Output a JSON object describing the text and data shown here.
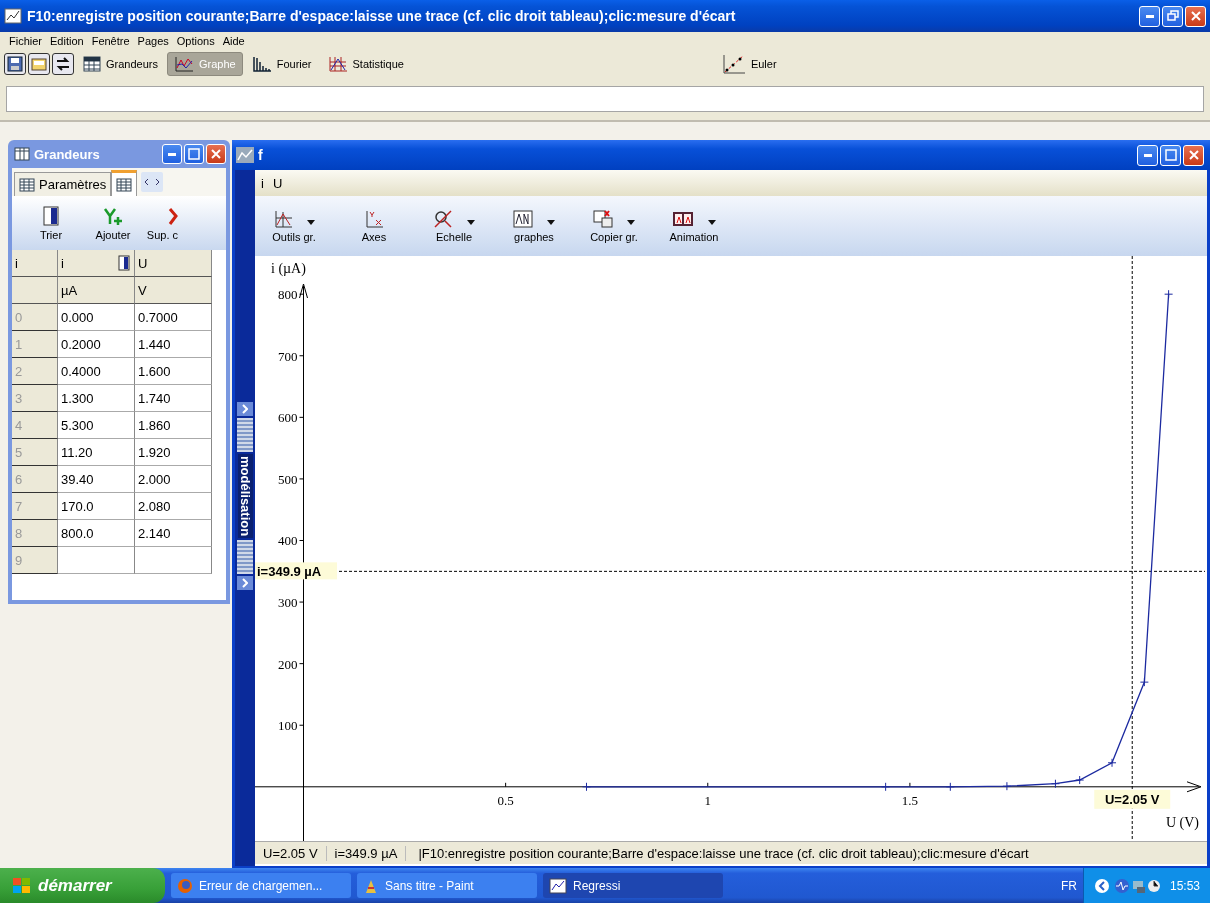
{
  "window": {
    "title": "F10:enregistre position courante;Barre d'espace:laisse une trace (cf. clic droit tableau);clic:mesure d'écart"
  },
  "menu": [
    "Fichier",
    "Edition",
    "Fenêtre",
    "Pages",
    "Options",
    "Aide"
  ],
  "toolbar": [
    {
      "label": "Grandeurs",
      "kind": "grandeurs",
      "selected": false
    },
    {
      "label": "Graphe",
      "kind": "graphe",
      "selected": true
    },
    {
      "label": "Fourier",
      "kind": "fourier",
      "selected": false
    },
    {
      "label": "Statistique",
      "kind": "stat",
      "selected": false
    },
    {
      "label": "Euler",
      "kind": "euler",
      "selected": false
    }
  ],
  "grandeurs": {
    "title": "Grandeurs",
    "tabs": [
      {
        "label": "Paramètres",
        "selected": false
      },
      {
        "selected": true
      }
    ],
    "tools": [
      {
        "label": "Trier",
        "kind": "sort"
      },
      {
        "label": "Ajouter",
        "kind": "add"
      },
      {
        "label": "Sup. c",
        "kind": "delete"
      }
    ],
    "header": [
      "i",
      "i",
      "U"
    ],
    "units": [
      "µA",
      "V"
    ],
    "rows": [
      {
        "index": "0",
        "i": "0.000",
        "u": "0.7000"
      },
      {
        "index": "1",
        "i": "0.2000",
        "u": "1.440"
      },
      {
        "index": "2",
        "i": "0.4000",
        "u": "1.600"
      },
      {
        "index": "3",
        "i": "1.300",
        "u": "1.740"
      },
      {
        "index": "4",
        "i": "5.300",
        "u": "1.860"
      },
      {
        "index": "5",
        "i": "11.20",
        "u": "1.920"
      },
      {
        "index": "6",
        "i": "39.40",
        "u": "2.000"
      },
      {
        "index": "7",
        "i": "170.0",
        "u": "2.080"
      },
      {
        "index": "8",
        "i": "800.0",
        "u": "2.140"
      },
      {
        "index": "9"
      }
    ]
  },
  "graph": {
    "title": "f",
    "variables": [
      "i",
      "U"
    ],
    "tools": [
      {
        "label": "Outils gr.",
        "kind": "tools",
        "dropdown": true
      },
      {
        "label": "Axes",
        "kind": "axes",
        "dropdown": false
      },
      {
        "label": "Echelle",
        "kind": "scale",
        "dropdown": true
      },
      {
        "label": "graphes",
        "kind": "graphs",
        "dropdown": true
      },
      {
        "label": "Copier gr.",
        "kind": "copy",
        "dropdown": true
      },
      {
        "label": "Animation",
        "kind": "animation",
        "dropdown": true
      }
    ],
    "side_label": "modélisation",
    "chart_data": {
      "type": "line",
      "xlabel": "U (V)",
      "ylabel": "i (µA)",
      "x": [
        0.7,
        1.44,
        1.6,
        1.74,
        1.86,
        1.92,
        2.0,
        2.08,
        2.14
      ],
      "series": [
        {
          "color": "#1c2aa0",
          "marker": "+",
          "values": [
            0,
            0,
            0,
            1,
            5,
            11,
            39,
            170,
            800
          ]
        }
      ],
      "xlim": [
        -0.12,
        2.23
      ],
      "ylim": [
        -88,
        862
      ],
      "xticks": [
        0.5,
        1,
        1.5
      ],
      "yticks": [
        100,
        200,
        300,
        400,
        500,
        600,
        700,
        800
      ],
      "ref_lines": [
        {
          "axis": "y",
          "value": 349.9,
          "label": "i=349.9 µA"
        },
        {
          "axis": "x",
          "value": 2.05,
          "label": "U=2.05 V"
        }
      ]
    },
    "status": [
      "U=2.05 V",
      "i=349.9 µA",
      "|F10:enregistre position courante;Barre d'espace:laisse une trace (cf. clic droit tableau);clic:mesure d'écart"
    ]
  },
  "taskbar": {
    "start": "démarrer",
    "tasks": [
      {
        "label": "Erreur de chargemen...",
        "kind": "browser",
        "selected": false
      },
      {
        "label": "Sans titre - Paint",
        "kind": "paint",
        "selected": false
      },
      {
        "label": "Regressi",
        "kind": "regressi",
        "selected": true
      }
    ],
    "language": "FR",
    "clock": "15:53"
  }
}
